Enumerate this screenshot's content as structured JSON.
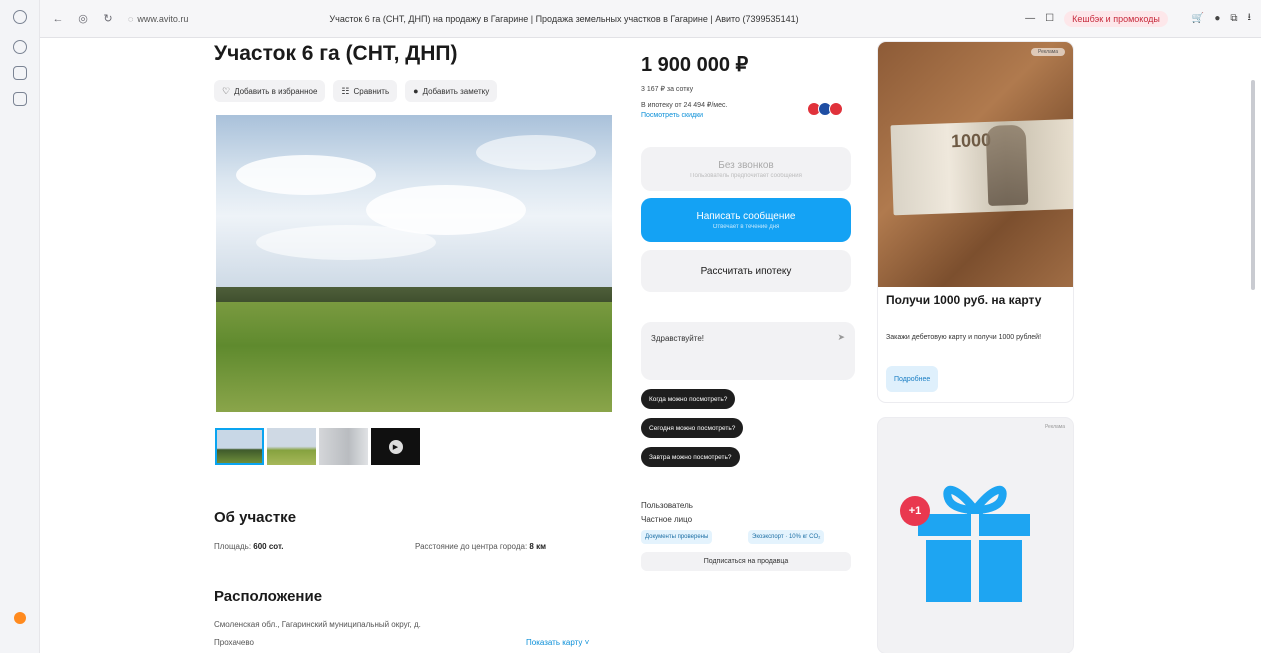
{
  "browser": {
    "url": "www.avito.ru",
    "tab_title": "Участок 6 га (СНТ, ДНП) на продажу в Гагарине | Продажа земельных участков в Гагарине | Авито (7399535141)",
    "promo_chip": "Кешбэк и промокоды"
  },
  "listing": {
    "title": "Участок 6 га (СНТ, ДНП)",
    "actions": {
      "favorite": "Добавить в избранное",
      "compare": "Сравнить",
      "note": "Добавить заметку"
    }
  },
  "about": {
    "heading": "Об участке",
    "area_label": "Площадь:",
    "area_value": "600 сот.",
    "distance_label": "Расстояние до центра города:",
    "distance_value": "8 км"
  },
  "location": {
    "heading": "Расположение",
    "address_line1": "Смоленская обл., Гагаринский муниципальный округ, д.",
    "address_line2": "Прохачево",
    "map_link": "Показать карту ˅"
  },
  "price": {
    "value": "1 900 000 ₽",
    "per_sotka": "3 167 ₽ за сотку",
    "mortgage": "В ипотеку от 24 494 ₽/мес.",
    "offers_link": "Посмотреть скидки"
  },
  "buttons": {
    "no_calls_main": "Без звонков",
    "no_calls_sub": "Пользователь предпочитает сообщения",
    "message_main": "Написать сообщение",
    "message_sub": "Отвечает в течение дня",
    "mortgage_calc": "Рассчитать ипотеку"
  },
  "chat": {
    "placeholder": "Здравствуйте!",
    "quick_replies": [
      "Когда можно посмотреть?",
      "Сегодня можно посмотреть?",
      "Завтра можно посмотреть?"
    ]
  },
  "seller": {
    "label": "Пользователь",
    "type": "Частное лицо",
    "tag_docs": "Документы проверены",
    "tag_eco": "Экоэкспорт · 10% кг CO₂",
    "subscribe": "Подписаться на продавца"
  },
  "ads": {
    "ad1_badge": "Реклама",
    "note_number": "1000",
    "ad1_title": "Получи 1000 руб. на карту",
    "ad1_text": "Закажи дебетовую карту и получи 1000 рублей!",
    "ad1_button": "Подробнее",
    "ad2_label": "Реклама",
    "ad2_plus": "+1"
  },
  "colors": {
    "accent": "#14a2f4",
    "gift": "#1ea5f2",
    "badge_red": "#e9384f"
  }
}
